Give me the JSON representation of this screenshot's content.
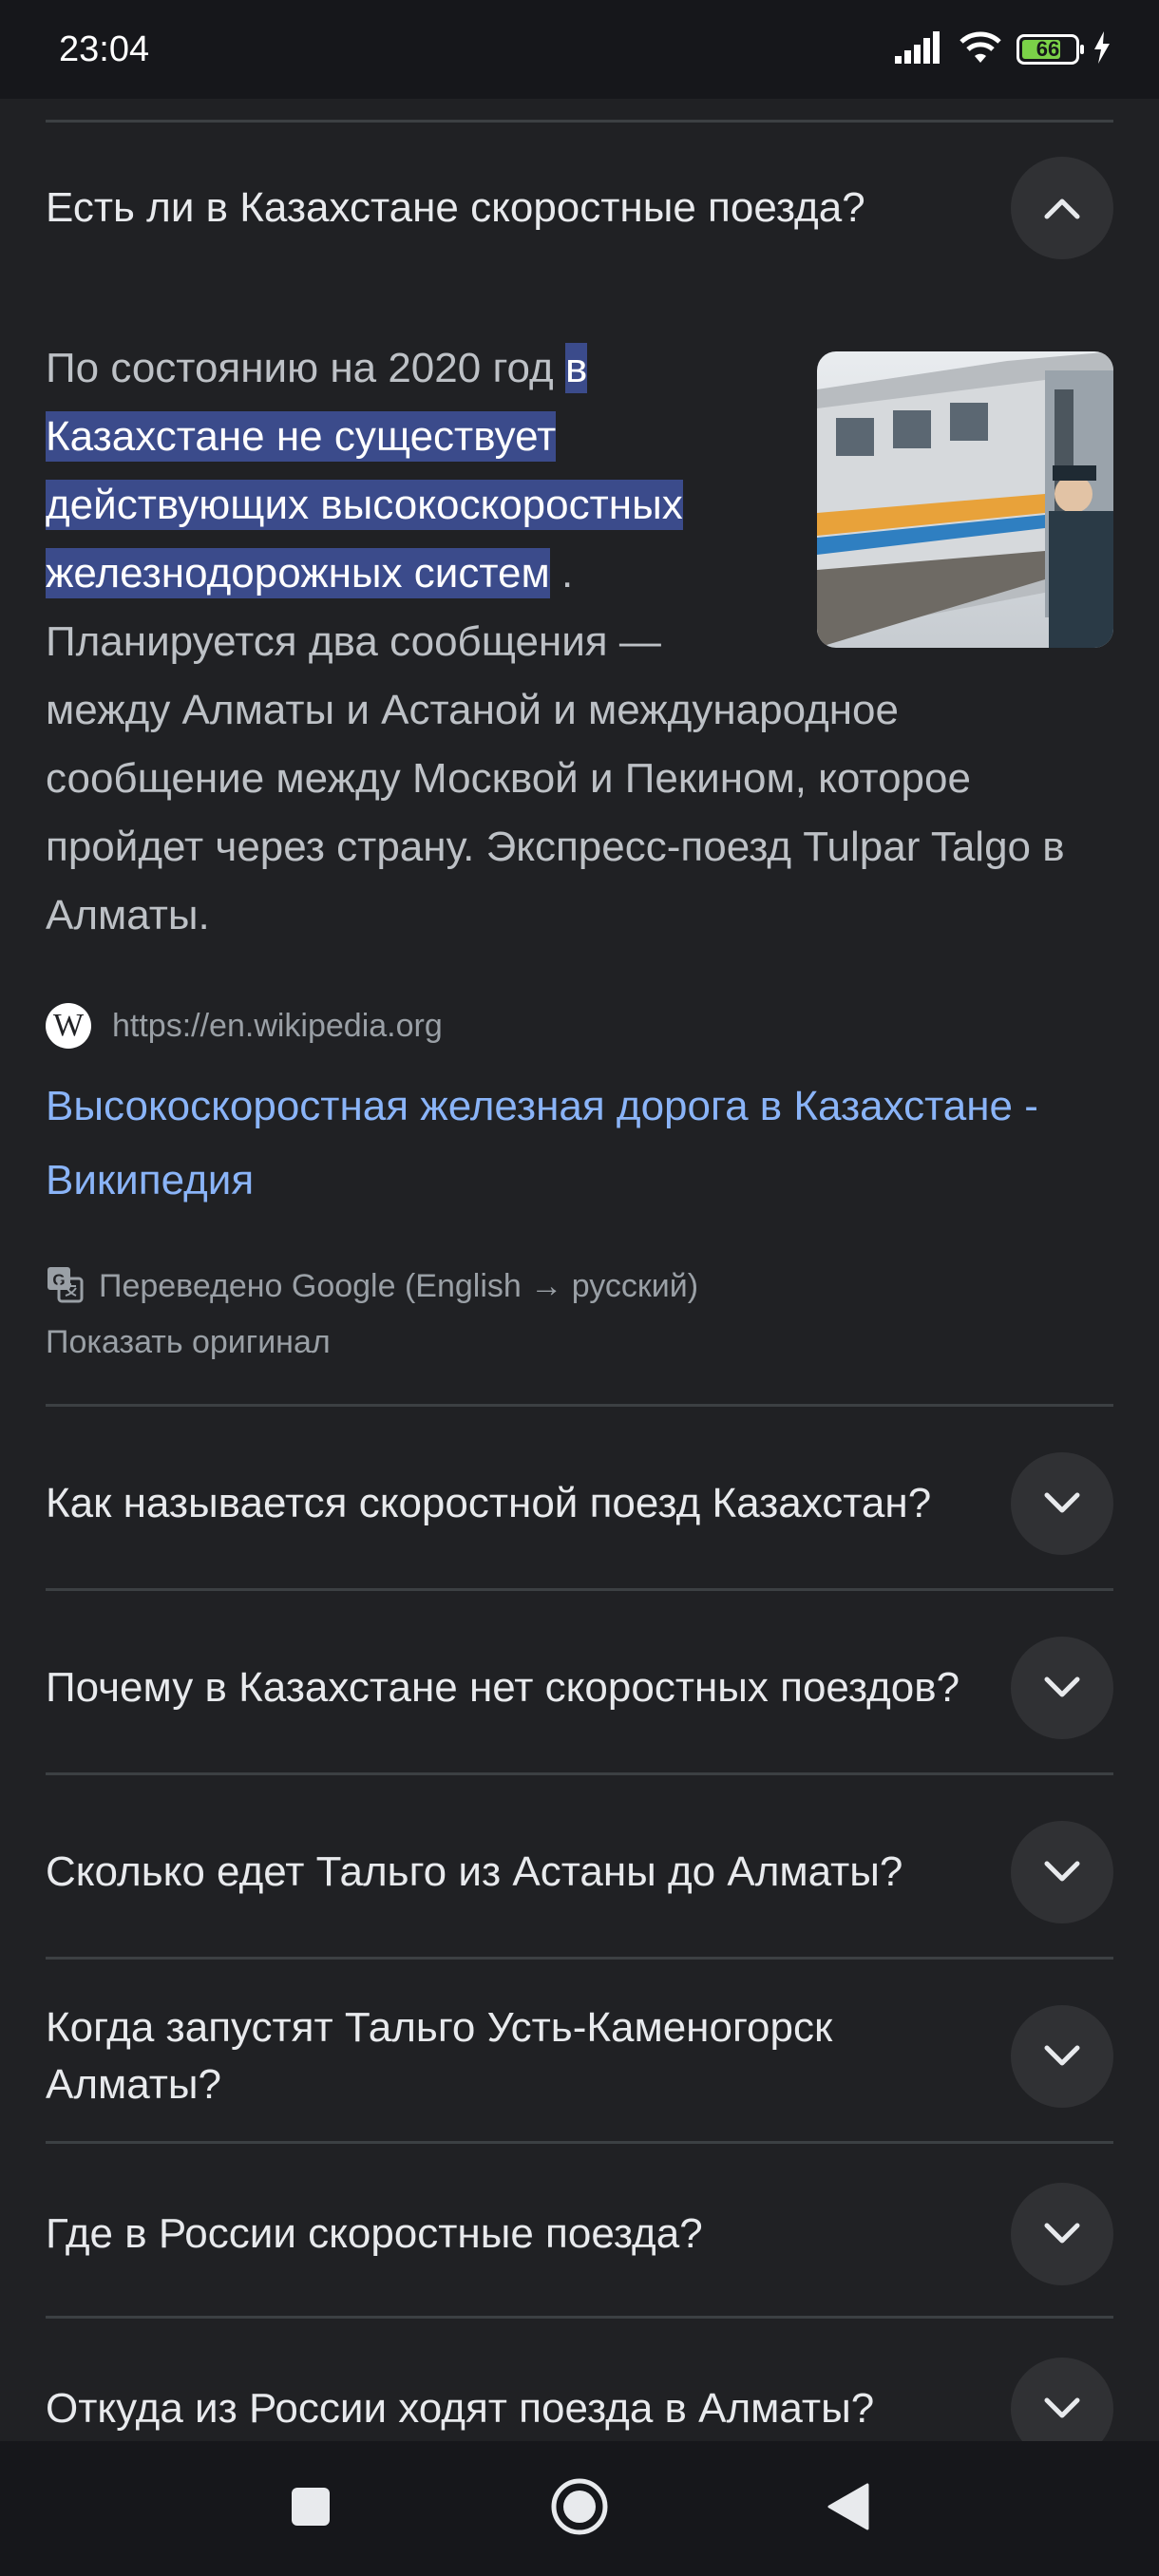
{
  "status_bar": {
    "time": "23:04",
    "battery_level": "66",
    "icons": [
      "signal-icon",
      "wifi-icon",
      "battery-icon",
      "charging-icon"
    ]
  },
  "expanded_question": {
    "text": "Есть ли в Казахстане скоростные поезда?",
    "icon": "chevron-up-icon"
  },
  "answer": {
    "text_before": "По состоянию на 2020 год ",
    "highlighted": "в Казахстане не существует действующих высокоскоростных железнодорожных систем",
    "text_after": " . Планируется два сообщения — между Алматы и Астаной и международное сообщение между Москвой и Пекином, которое пройдет через страну. Экспресс-поезд Tulpar Talgo в Алматы."
  },
  "source": {
    "logo_letter": "W",
    "url": "https://en.wikipedia.org",
    "title": "Высокоскоростная железная дорога в Казахстане - Википедия"
  },
  "translation": {
    "note": "Переведено Google (English → русский)",
    "show_original": "Показать оригинал"
  },
  "questions": [
    "Как называется скоростной поезд Казахстан?",
    "Почему в Казахстане нет скоростных поездов?",
    "Сколько едет Тальго из Астаны до Алматы?",
    "Когда запустят Тальго Усть-Каменогорск Алматы?",
    "Где в России скоростные поезда?",
    "Откуда из России ходят поезда в Алматы?"
  ],
  "colors": {
    "background": "#202124",
    "highlight": "#3b4b8b",
    "link": "#8ab4f8",
    "muted": "#9aa0a6"
  }
}
